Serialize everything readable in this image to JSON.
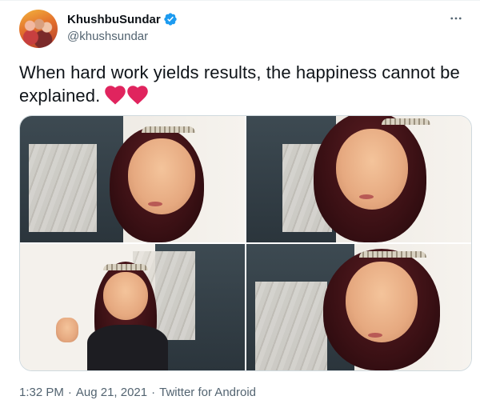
{
  "tweet": {
    "display_name": "KhushbuSundar",
    "handle": "@khushsundar",
    "text": "When hard work yields results, the happiness cannot be explained.",
    "time": "1:32 PM",
    "date": "Aug 21, 2021",
    "separator": "·",
    "source": "Twitter for Android"
  },
  "icons": {
    "verified": "verified-badge-icon",
    "more": "more-options-icon",
    "heart": "red-heart-emoji"
  },
  "colors": {
    "verified": "#1d9bf0",
    "heart": "#e0245e",
    "secondary_text": "#536471",
    "primary_text": "#0f1419",
    "border": "#cfd9de"
  }
}
